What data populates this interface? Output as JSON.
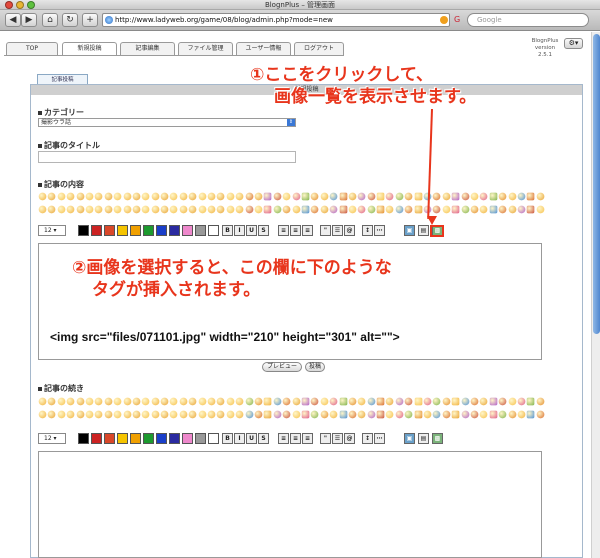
{
  "window": {
    "title": "BlognPlus – 管理画面"
  },
  "browser": {
    "address": "http://www.ladyweb.org/game/08/blog/admin.php?mode=new",
    "search_engine": "G",
    "search_placeholder": "Google"
  },
  "app": {
    "tabs": [
      "TOP",
      "新規投稿",
      "記事編集",
      "ファイル管理",
      "ユーザー情報",
      "ログアウト"
    ],
    "version_name": "BlognPlus",
    "version_label": "version",
    "version_number": "2.5.1"
  },
  "form": {
    "panel_tab": "記事投稿",
    "panel_title": "新規投稿",
    "category_label": "カテゴリー",
    "category_value": "撮影ウラ話",
    "title_label": "記事のタイトル",
    "content_label": "記事の内容",
    "continuation_label": "記事の続き",
    "font_size": "12",
    "code_sample": "<img src=\"files/071101.jpg\" width=\"210\" height=\"301\" alt=\"\">",
    "preview_button": "プレビュー",
    "post_button": "投稿"
  },
  "annotations": {
    "step1_line1": "①ここをクリックして、",
    "step1_line2": "画像一覧を表示させます。",
    "step2_line1": "②画像を選択すると、この欄に下のような",
    "step2_line2": "タグが挿入されます。"
  },
  "colors": {
    "palette": [
      "#000000",
      "#cc2222",
      "#d9482a",
      "#f5c400",
      "#f0a000",
      "#1d9a2f",
      "#1a3fc9",
      "#2a2aa0",
      "#ee88cc",
      "#999999",
      "#ffffff"
    ],
    "annotation": "#e8351c"
  }
}
